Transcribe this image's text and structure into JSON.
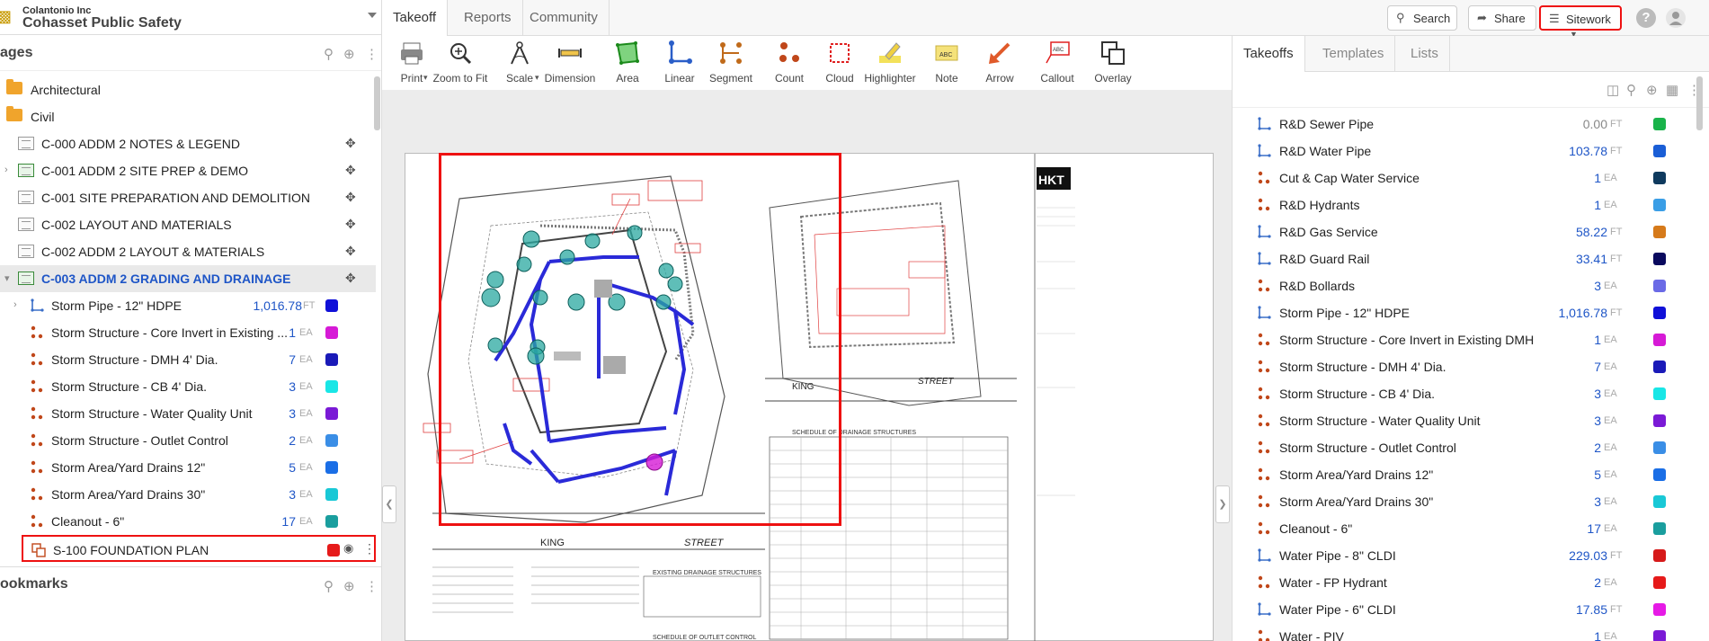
{
  "project": {
    "company": "Colantonio Inc",
    "name": "Cohasset Public Safety"
  },
  "pages_section": {
    "title": "ages",
    "bookmarks_title": "ookmarks"
  },
  "pages": [
    {
      "type": "folder",
      "label": "Architectural"
    },
    {
      "type": "folder",
      "label": "Civil"
    },
    {
      "type": "sheet",
      "label": "C-000 ADDM 2 NOTES & LEGEND",
      "green": false
    },
    {
      "type": "sheet",
      "label": "C-001 ADDM 2 SITE PREP & DEMO",
      "green": true
    },
    {
      "type": "sheet",
      "label": "C-001 SITE PREPARATION AND DEMOLITION",
      "green": false
    },
    {
      "type": "sheet",
      "label": "C-002 LAYOUT AND MATERIALS",
      "green": false
    },
    {
      "type": "sheet",
      "label": "C-002 ADDM 2 LAYOUT & MATERIALS",
      "green": false
    },
    {
      "type": "sheet",
      "label": "C-003 ADDM 2 GRADING AND DRAINAGE",
      "green": true,
      "selected": true
    }
  ],
  "page_takeoffs": [
    {
      "label": "Storm Pipe - 12\" HDPE",
      "value": "1,016.78",
      "unit": "FT",
      "color": "#1010d8",
      "icon": "linear"
    },
    {
      "label": "Storm Structure - Core Invert in Existing ...",
      "value": "1",
      "unit": "EA",
      "color": "#d61ad6",
      "icon": "count"
    },
    {
      "label": "Storm Structure - DMH 4' Dia.",
      "value": "7",
      "unit": "EA",
      "color": "#1a1ab8",
      "icon": "count"
    },
    {
      "label": "Storm Structure - CB 4' Dia.",
      "value": "3",
      "unit": "EA",
      "color": "#19e6e6",
      "icon": "count"
    },
    {
      "label": "Storm Structure - Water Quality Unit",
      "value": "3",
      "unit": "EA",
      "color": "#7a1ad6",
      "icon": "count"
    },
    {
      "label": "Storm Structure - Outlet Control",
      "value": "2",
      "unit": "EA",
      "color": "#3a8ee6",
      "icon": "count"
    },
    {
      "label": "Storm Area/Yard Drains 12\"",
      "value": "5",
      "unit": "EA",
      "color": "#1a6ee6",
      "icon": "count"
    },
    {
      "label": "Storm Area/Yard Drains 30\"",
      "value": "3",
      "unit": "EA",
      "color": "#19c8d6",
      "icon": "count"
    },
    {
      "label": "Cleanout - 6\"",
      "value": "17",
      "unit": "EA",
      "color": "#1a9e9e",
      "icon": "count"
    },
    {
      "label": "S-100 FOUNDATION PLAN",
      "value": "",
      "unit": "",
      "color": "#e61a1a",
      "icon": "overlay",
      "highlight": true
    }
  ],
  "main_tabs": [
    "Takeoff",
    "Reports",
    "Community"
  ],
  "top_buttons": {
    "search": "Search",
    "share": "Share",
    "sitework": "Sitework"
  },
  "tools": [
    {
      "label": "Print",
      "icon": "print-icon"
    },
    {
      "label": "Zoom to Fit",
      "icon": "zoom-icon"
    },
    {
      "label": "Scale",
      "icon": "scale-icon"
    },
    {
      "label": "Dimension",
      "icon": "dimension-icon"
    },
    {
      "label": "Area",
      "icon": "area-icon"
    },
    {
      "label": "Linear",
      "icon": "linear-icon"
    },
    {
      "label": "Segment",
      "icon": "segment-icon"
    },
    {
      "label": "Count",
      "icon": "count-icon"
    },
    {
      "label": "Cloud",
      "icon": "cloud-icon"
    },
    {
      "label": "Highlighter",
      "icon": "highlighter-icon"
    },
    {
      "label": "Note",
      "icon": "note-icon"
    },
    {
      "label": "Arrow",
      "icon": "arrow-icon"
    },
    {
      "label": "Callout",
      "icon": "callout-icon"
    },
    {
      "label": "Overlay",
      "icon": "overlay-icon"
    }
  ],
  "drawing": {
    "street_label_1": "KING",
    "street_label_2": "STREET",
    "street_label_3": "KING",
    "street_label_4": "STREET",
    "firm_logo": "HKT",
    "schedule_title": "SCHEDULE OF DRAINAGE STRUCTURES",
    "existing_title": "EXISTING DRAINAGE STRUCTURES",
    "outlet_title": "SCHEDULE OF OUTLET CONTROL"
  },
  "right_tabs": [
    "Takeoffs",
    "Templates",
    "Lists"
  ],
  "takeoffs": [
    {
      "label": "R&D Sewer Pipe",
      "value": "0.00",
      "unit": "FT",
      "color": "#19b34a",
      "icon": "linear",
      "muted": true
    },
    {
      "label": "R&D Water Pipe",
      "value": "103.78",
      "unit": "FT",
      "color": "#1a5ed6",
      "icon": "linear"
    },
    {
      "label": "Cut & Cap Water Service",
      "value": "1",
      "unit": "EA",
      "color": "#0f3a5e",
      "icon": "count"
    },
    {
      "label": "R&D Hydrants",
      "value": "1",
      "unit": "EA",
      "color": "#3a9ee6",
      "icon": "count"
    },
    {
      "label": "R&D Gas Service",
      "value": "58.22",
      "unit": "FT",
      "color": "#d67a1a",
      "icon": "linear"
    },
    {
      "label": "R&D Guard Rail",
      "value": "33.41",
      "unit": "FT",
      "color": "#0a0a5e",
      "icon": "linear"
    },
    {
      "label": "R&D Bollards",
      "value": "3",
      "unit": "EA",
      "color": "#6a6ae6",
      "icon": "count"
    },
    {
      "label": "Storm Pipe - 12\" HDPE",
      "value": "1,016.78",
      "unit": "FT",
      "color": "#1010d8",
      "icon": "linear"
    },
    {
      "label": "Storm Structure - Core Invert in Existing DMH",
      "value": "1",
      "unit": "EA",
      "color": "#d61ad6",
      "icon": "count"
    },
    {
      "label": "Storm Structure - DMH 4' Dia.",
      "value": "7",
      "unit": "EA",
      "color": "#1a1ab8",
      "icon": "count"
    },
    {
      "label": "Storm Structure - CB 4' Dia.",
      "value": "3",
      "unit": "EA",
      "color": "#19e6e6",
      "icon": "count"
    },
    {
      "label": "Storm Structure - Water Quality Unit",
      "value": "3",
      "unit": "EA",
      "color": "#7a1ad6",
      "icon": "count"
    },
    {
      "label": "Storm Structure - Outlet Control",
      "value": "2",
      "unit": "EA",
      "color": "#3a8ee6",
      "icon": "count"
    },
    {
      "label": "Storm Area/Yard Drains 12\"",
      "value": "5",
      "unit": "EA",
      "color": "#1a6ee6",
      "icon": "count"
    },
    {
      "label": "Storm Area/Yard Drains 30\"",
      "value": "3",
      "unit": "EA",
      "color": "#19c8d6",
      "icon": "count"
    },
    {
      "label": "Cleanout - 6\"",
      "value": "17",
      "unit": "EA",
      "color": "#1a9e9e",
      "icon": "count"
    },
    {
      "label": "Water Pipe - 8\" CLDI",
      "value": "229.03",
      "unit": "FT",
      "color": "#d61a1a",
      "icon": "linear"
    },
    {
      "label": "Water - FP Hydrant",
      "value": "2",
      "unit": "EA",
      "color": "#e61a1a",
      "icon": "count"
    },
    {
      "label": "Water Pipe - 6\" CLDI",
      "value": "17.85",
      "unit": "FT",
      "color": "#e61ae6",
      "icon": "linear"
    },
    {
      "label": "Water - PIV",
      "value": "1",
      "unit": "EA",
      "color": "#7a1ad6",
      "icon": "count"
    }
  ],
  "colors": {
    "accent_blue": "#1f56c7",
    "highlight_red": "#e11111",
    "value_blue": "#1f56c7"
  }
}
